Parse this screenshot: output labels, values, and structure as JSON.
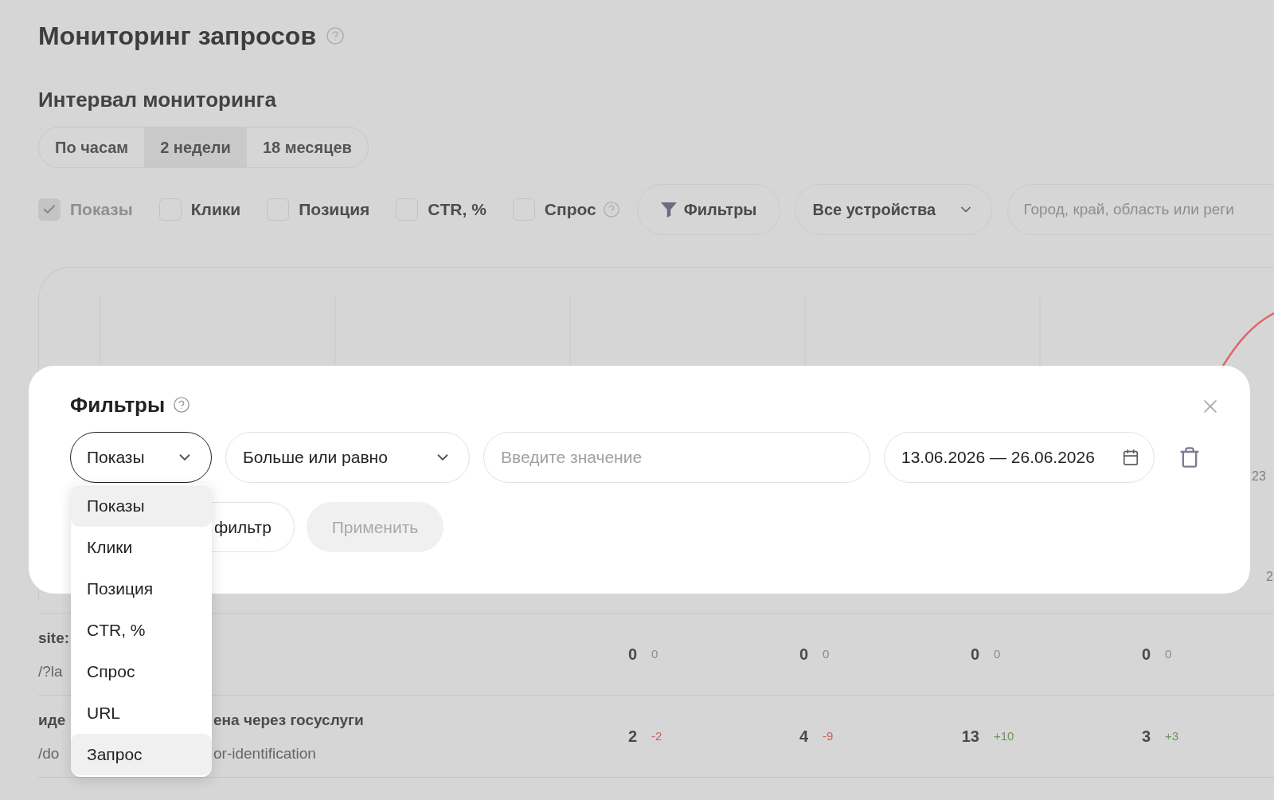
{
  "page": {
    "title": "Мониторинг запросов",
    "interval": {
      "heading": "Интервал мониторинга",
      "options": [
        {
          "label": "По часам",
          "selected": false
        },
        {
          "label": "2 недели",
          "selected": true
        },
        {
          "label": "18 месяцев",
          "selected": false
        }
      ]
    },
    "metrics": [
      {
        "label": "Показы",
        "checked": true,
        "disabled": true
      },
      {
        "label": "Клики",
        "checked": false,
        "disabled": false
      },
      {
        "label": "Позиция",
        "checked": false,
        "disabled": false
      },
      {
        "label": "CTR, %",
        "checked": false,
        "disabled": false
      },
      {
        "label": "Спрос",
        "checked": false,
        "disabled": false,
        "help": true
      }
    ],
    "filters_button": {
      "label": "Фильтры"
    },
    "device_select": {
      "value": "Все устройства"
    },
    "region_field": {
      "placeholder": "Город, край, область или реги"
    },
    "chart": {
      "axis_labels": [
        "23",
        "2"
      ]
    },
    "table": {
      "rows": [
        {
          "title_parts": [
            "site:"
          ],
          "url_parts": [
            "/?la"
          ],
          "values": [
            {
              "value": "0",
              "delta": "0",
              "color": "#8a8a8a"
            },
            {
              "value": "0",
              "delta": "0",
              "color": "#8a8a8a"
            },
            {
              "value": "0",
              "delta": "0",
              "color": "#8a8a8a"
            },
            {
              "value": "0",
              "delta": "0",
              "color": "#8a8a8a"
            }
          ]
        },
        {
          "title_parts": [
            "иде",
            "ена через госуслуги"
          ],
          "url_parts": [
            "/do",
            "or-identification"
          ],
          "values": [
            {
              "value": "2",
              "delta": "-2",
              "color": "#d05c5c"
            },
            {
              "value": "4",
              "delta": "-9",
              "color": "#d05c5c"
            },
            {
              "value": "13",
              "delta": "+10",
              "color": "#6f9362"
            },
            {
              "value": "3",
              "delta": "+3",
              "color": "#6f9362"
            }
          ]
        }
      ]
    }
  },
  "filters_dialog": {
    "title": "Фильтры",
    "field_select": {
      "value": "Показы",
      "open": true,
      "options": [
        {
          "label": "Показы",
          "highlighted": true
        },
        {
          "label": "Клики",
          "highlighted": false
        },
        {
          "label": "Позиция",
          "highlighted": false
        },
        {
          "label": "CTR, %",
          "highlighted": false
        },
        {
          "label": "Спрос",
          "highlighted": false
        },
        {
          "label": "URL",
          "highlighted": false
        },
        {
          "label": "Запрос",
          "highlighted": true
        }
      ]
    },
    "operator_select": {
      "value": "Больше или равно"
    },
    "value_field": {
      "placeholder": "Введите значение"
    },
    "date_range": {
      "value": "13.06.2026 — 26.06.2026"
    },
    "add_button": {
      "label": "фильтр"
    },
    "apply_button": {
      "label": "Применить",
      "disabled": true
    }
  }
}
